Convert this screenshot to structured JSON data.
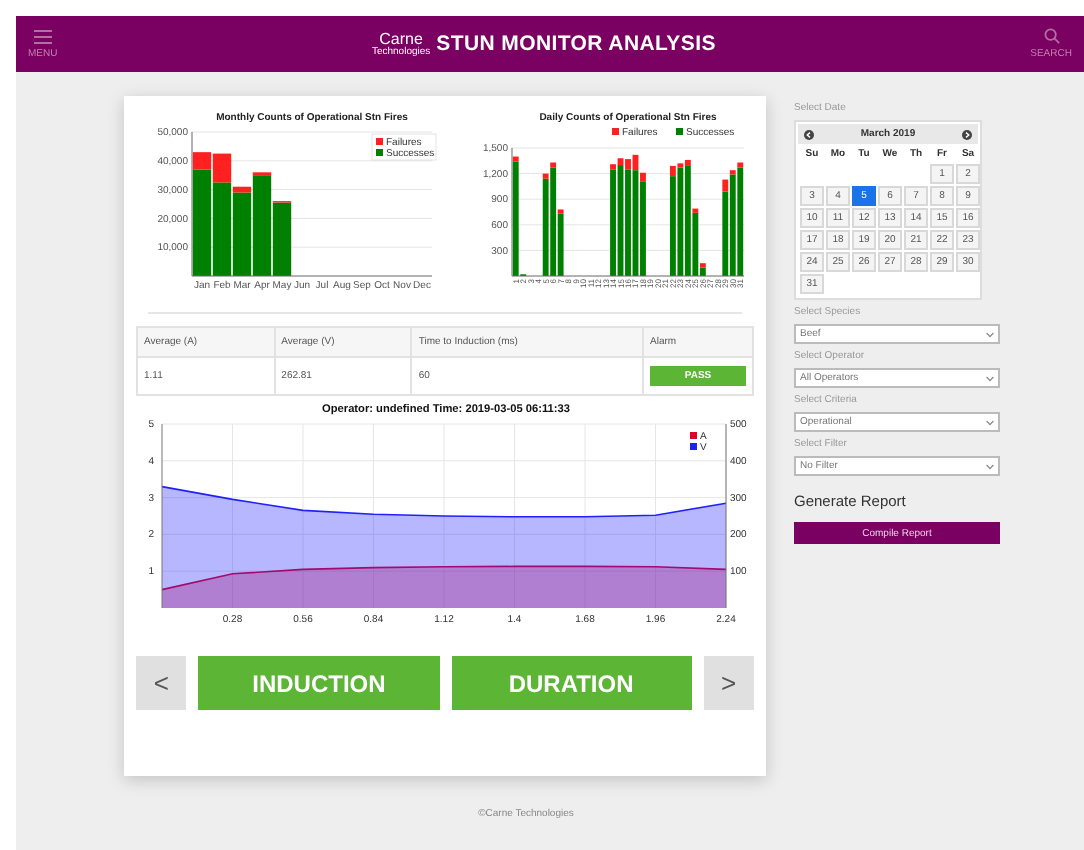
{
  "header": {
    "menu_label": "MENU",
    "logo": "Carne",
    "logo_sub": "Technologies",
    "title": "STUN MONITOR ANALYSIS",
    "search_label": "SEARCH"
  },
  "monthly_chart": {
    "chart_data": {
      "type": "bar",
      "stacked": true,
      "grid": true,
      "legend": true,
      "title": "Monthly Counts of Operational Stn Fires",
      "categories": [
        "Jan",
        "Feb",
        "Mar",
        "Apr",
        "May",
        "Jun",
        "Jul",
        "Aug",
        "Sep",
        "Oct",
        "Nov",
        "Dec"
      ],
      "ylim": [
        0,
        50000
      ],
      "yticks": [
        {
          "value": 10000,
          "label": "10,000"
        },
        {
          "value": 20000,
          "label": "20,000"
        },
        {
          "value": 30000,
          "label": "30,000"
        },
        {
          "value": 40000,
          "label": "40,000"
        },
        {
          "value": 50000,
          "label": "50,000"
        }
      ],
      "series": [
        {
          "name": "Successes",
          "color": "#008000",
          "values": [
            37000,
            32500,
            29000,
            35000,
            25500,
            0,
            0,
            0,
            0,
            0,
            0,
            0
          ]
        },
        {
          "name": "Failures",
          "color": "#ff2020",
          "values": [
            6000,
            10000,
            2000,
            1000,
            500,
            0,
            0,
            0,
            0,
            0,
            0,
            0
          ]
        }
      ]
    }
  },
  "daily_chart": {
    "chart_data": {
      "type": "bar",
      "stacked": true,
      "grid": true,
      "legend": true,
      "title": "Daily Counts of Operational Stn Fires",
      "categories": [
        "1",
        "2",
        "3",
        "4",
        "5",
        "6",
        "7",
        "8",
        "9",
        "10",
        "11",
        "12",
        "13",
        "14",
        "15",
        "16",
        "17",
        "18",
        "19",
        "20",
        "21",
        "22",
        "23",
        "24",
        "25",
        "26",
        "27",
        "28",
        "29",
        "30",
        "31"
      ],
      "ylim": [
        0,
        1500
      ],
      "yticks": [
        {
          "value": 300,
          "label": "300"
        },
        {
          "value": 600,
          "label": "600"
        },
        {
          "value": 900,
          "label": "900"
        },
        {
          "value": 1200,
          "label": "1,200"
        },
        {
          "value": 1500,
          "label": "1,500"
        }
      ],
      "series": [
        {
          "name": "Successes",
          "color": "#008000",
          "values": [
            1340,
            20,
            0,
            0,
            1140,
            1270,
            730,
            0,
            0,
            0,
            0,
            0,
            0,
            1250,
            1300,
            1250,
            1240,
            1110,
            0,
            0,
            0,
            1170,
            1270,
            1290,
            740,
            100,
            0,
            0,
            990,
            1190,
            1270
          ]
        },
        {
          "name": "Failures",
          "color": "#ff2020",
          "values": [
            60,
            0,
            0,
            0,
            60,
            60,
            50,
            0,
            0,
            0,
            0,
            0,
            0,
            60,
            80,
            120,
            180,
            100,
            0,
            0,
            0,
            120,
            50,
            70,
            50,
            50,
            0,
            0,
            140,
            50,
            60
          ]
        }
      ]
    }
  },
  "table": {
    "columns": [
      "Average (A)",
      "Average (V)",
      "Time to Induction (ms)",
      "Alarm"
    ],
    "row": [
      "1.11",
      "262.81",
      "60"
    ],
    "alarm": "PASS"
  },
  "line_chart": {
    "chart_data": {
      "type": "area",
      "title": "Operator: undefined Time: 2019-03-05 06:11:33",
      "x": [
        0,
        0.28,
        0.56,
        0.84,
        1.12,
        1.4,
        1.68,
        1.96,
        2.24
      ],
      "xlim": [
        0,
        2.24
      ],
      "xticks": [
        0.28,
        0.56,
        0.84,
        1.12,
        1.4,
        1.68,
        1.96,
        2.24
      ],
      "ylim": [
        0,
        5
      ],
      "yticks": [
        1,
        2,
        3,
        4,
        5
      ],
      "y2lim": [
        0,
        500
      ],
      "y2ticks": [
        100,
        200,
        300,
        400,
        500
      ],
      "legend": true,
      "grid": true,
      "series": [
        {
          "name": "A",
          "color": "#e0002a",
          "values": [
            0.5,
            0.93,
            1.05,
            1.1,
            1.12,
            1.13,
            1.13,
            1.12,
            1.05
          ]
        },
        {
          "name": "V",
          "color": "#2020ff",
          "axis": "y2",
          "values": [
            330,
            295,
            265,
            255,
            250,
            248,
            248,
            252,
            285
          ]
        }
      ]
    }
  },
  "nav": {
    "prev": "<",
    "next": ">",
    "buttons": [
      "INDUCTION",
      "DURATION"
    ]
  },
  "footer": "©Carne Technologies",
  "sidebar": {
    "date_label": "Select Date",
    "calendar": {
      "month": "March 2019",
      "weekdays": [
        "Su",
        "Mo",
        "Tu",
        "We",
        "Th",
        "Fr",
        "Sa"
      ],
      "weeks": [
        [
          {
            "day": "1",
            "selected": false
          },
          {
            "day": "2",
            "selected": false
          }
        ],
        [
          {
            "day": "3",
            "selected": false
          },
          {
            "day": "4",
            "selected": false
          },
          {
            "day": "5",
            "selected": true
          },
          {
            "day": "6",
            "selected": false
          },
          {
            "day": "7",
            "selected": false
          },
          {
            "day": "8",
            "selected": false
          },
          {
            "day": "9",
            "selected": false
          }
        ],
        [
          {
            "day": "10",
            "selected": false
          },
          {
            "day": "11",
            "selected": false
          },
          {
            "day": "12",
            "selected": false
          },
          {
            "day": "13",
            "selected": false
          },
          {
            "day": "14",
            "selected": false
          },
          {
            "day": "15",
            "selected": false
          },
          {
            "day": "16",
            "selected": false
          }
        ],
        [
          {
            "day": "17",
            "selected": false
          },
          {
            "day": "18",
            "selected": false
          },
          {
            "day": "19",
            "selected": false
          },
          {
            "day": "20",
            "selected": false
          },
          {
            "day": "21",
            "selected": false
          },
          {
            "day": "22",
            "selected": false
          },
          {
            "day": "23",
            "selected": false
          }
        ],
        [
          {
            "day": "24",
            "selected": false
          },
          {
            "day": "25",
            "selected": false
          },
          {
            "day": "26",
            "selected": false
          },
          {
            "day": "27",
            "selected": false
          },
          {
            "day": "28",
            "selected": false
          },
          {
            "day": "29",
            "selected": false
          },
          {
            "day": "30",
            "selected": false
          }
        ],
        [
          {
            "day": "31",
            "selected": false
          }
        ]
      ]
    },
    "selects": [
      {
        "label": "Select Species",
        "value": "Beef"
      },
      {
        "label": "Select Operator",
        "value": "All Operators"
      },
      {
        "label": "Select Criteria",
        "value": "Operational"
      },
      {
        "label": "Select Filter",
        "value": "No Filter"
      }
    ],
    "report_heading": "Generate Report",
    "report_button": "Compile Report"
  }
}
